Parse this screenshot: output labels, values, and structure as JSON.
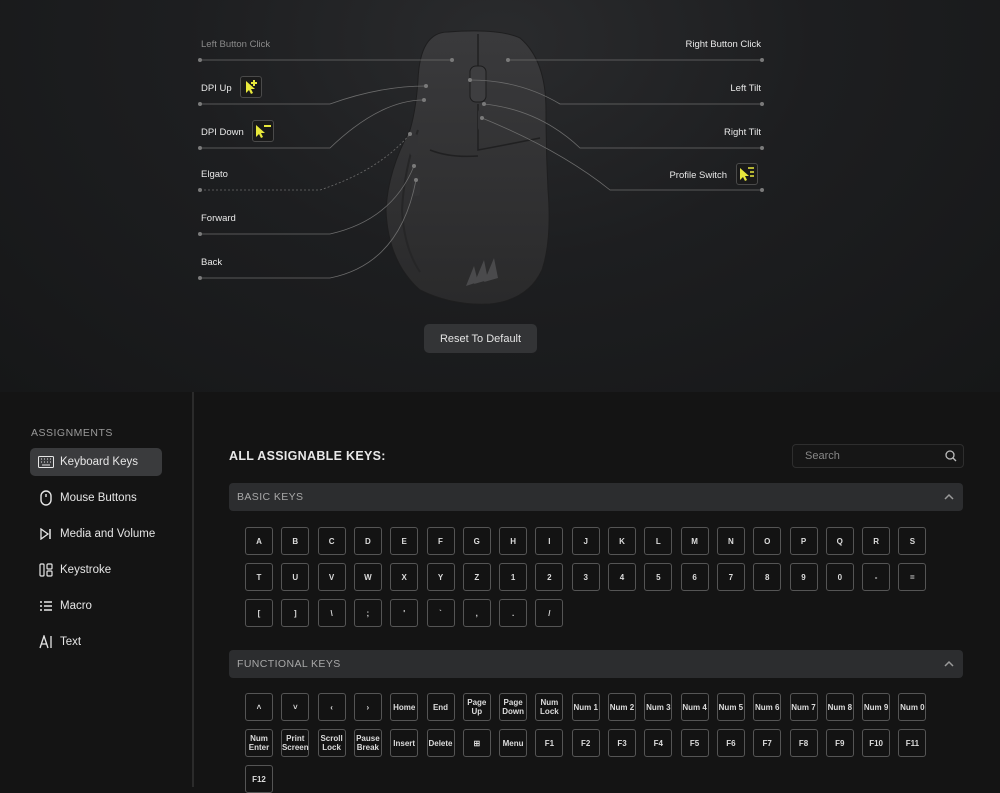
{
  "mouse_panel": {
    "left_labels": {
      "left_button_click": "Left Button Click",
      "dpi_up": "DPI Up",
      "dpi_down": "DPI Down",
      "elgato": "Elgato",
      "forward": "Forward",
      "back": "Back"
    },
    "right_labels": {
      "right_button_click": "Right Button Click",
      "left_tilt": "Left Tilt",
      "right_tilt": "Right Tilt",
      "profile_switch": "Profile Switch"
    },
    "accent_color": "#e8e83c",
    "reset_label": "Reset To Default"
  },
  "sidebar": {
    "heading": "ASSIGNMENTS",
    "items": [
      {
        "label": "Keyboard Keys",
        "icon": "keyboard-icon",
        "active": true
      },
      {
        "label": "Mouse Buttons",
        "icon": "mouse-icon",
        "active": false
      },
      {
        "label": "Media and Volume",
        "icon": "media-icon",
        "active": false
      },
      {
        "label": "Keystroke",
        "icon": "keystroke-icon",
        "active": false
      },
      {
        "label": "Macro",
        "icon": "macro-icon",
        "active": false
      },
      {
        "label": "Text",
        "icon": "text-icon",
        "active": false
      }
    ]
  },
  "main": {
    "title": "ALL ASSIGNABLE KEYS:",
    "search": {
      "placeholder": "Search",
      "value": ""
    },
    "basic_section": {
      "title": "BASIC KEYS",
      "rows": [
        [
          "A",
          "B",
          "C",
          "D",
          "E",
          "F",
          "G",
          "H",
          "I",
          "J",
          "K",
          "L",
          "M",
          "N",
          "O",
          "P",
          "Q",
          "R",
          "S"
        ],
        [
          "T",
          "U",
          "V",
          "W",
          "X",
          "Y",
          "Z",
          "1",
          "2",
          "3",
          "4",
          "5",
          "6",
          "7",
          "8",
          "9",
          "0",
          "-",
          "="
        ],
        [
          "[",
          "]",
          "\\",
          ";",
          "'",
          "`",
          ",",
          ".",
          "/"
        ]
      ]
    },
    "functional_section": {
      "title": "FUNCTIONAL KEYS",
      "rows": [
        [
          "˄",
          "˅",
          "‹",
          "›",
          "Home",
          "End",
          "Page Up",
          "Page Down",
          "Num Lock",
          "Num 1",
          "Num 2",
          "Num 3",
          "Num 4",
          "Num 5",
          "Num 6",
          "Num 7",
          "Num 8",
          "Num 9",
          "Num 0"
        ],
        [
          "Num Enter",
          "Print Screen",
          "Scroll Lock",
          "Pause Break",
          "Insert",
          "Delete",
          "⊞",
          "Menu",
          "F1",
          "F2",
          "F3",
          "F4",
          "F5",
          "F6",
          "F7",
          "F8",
          "F9",
          "F10",
          "F11"
        ],
        [
          "F12"
        ]
      ]
    }
  }
}
